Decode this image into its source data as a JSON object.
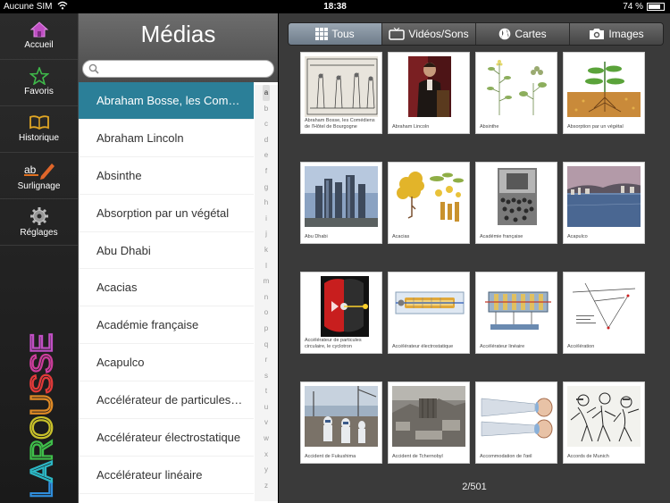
{
  "status": {
    "carrier": "Aucune SIM",
    "time": "18:38",
    "battery": "74 %",
    "battery_level": 0.74
  },
  "nav": [
    {
      "label": "Accueil",
      "icon": "home-icon"
    },
    {
      "label": "Favoris",
      "icon": "star-icon"
    },
    {
      "label": "Historique",
      "icon": "book-icon"
    },
    {
      "label": "Surlignage",
      "icon": "highlighter-icon"
    },
    {
      "label": "Réglages",
      "icon": "gear-icon"
    }
  ],
  "brand": "LAROUSSE",
  "list": {
    "title": "Médias",
    "search_placeholder": "",
    "items": [
      "Abraham Bosse, les Com…",
      "Abraham Lincoln",
      "Absinthe",
      "Absorption par un végétal",
      "Abu Dhabi",
      "Acacias",
      "Académie française",
      "Acapulco",
      "Accélérateur de particules…",
      "Accélérateur électrostatique",
      "Accélérateur linéaire"
    ],
    "index": [
      "a",
      "b",
      "c",
      "d",
      "e",
      "f",
      "g",
      "h",
      "i",
      "j",
      "k",
      "l",
      "m",
      "n",
      "o",
      "p",
      "q",
      "r",
      "s",
      "t",
      "u",
      "v",
      "w",
      "x",
      "y",
      "z"
    ]
  },
  "tabs": [
    {
      "label": "Tous",
      "icon": "grid-icon",
      "active": true
    },
    {
      "label": "Vidéos/Sons",
      "icon": "tv-icon",
      "active": false
    },
    {
      "label": "Cartes",
      "icon": "globe-icon",
      "active": false
    },
    {
      "label": "Images",
      "icon": "camera-icon",
      "active": false
    }
  ],
  "tiles": [
    "Abraham Bosse, les Comédiens de l'Hôtel de Bourgogne",
    "Abraham Lincoln",
    "Absinthe",
    "Absorption par un végétal",
    "Abu Dhabi",
    "Acacias",
    "Académie française",
    "Acapulco",
    "Accélérateur de particules circulaire, le cyclotron",
    "Accélérateur électrostatique",
    "Accélérateur linéaire",
    "Accélération",
    "Accident de Fukushima",
    "Accident de Tchernobyl",
    "Accommodation de l'œil",
    "Accords de Munich"
  ],
  "pager": "2/501",
  "colors": {
    "accent": "#2b7f98",
    "content_bg": "#3a3a3a"
  }
}
